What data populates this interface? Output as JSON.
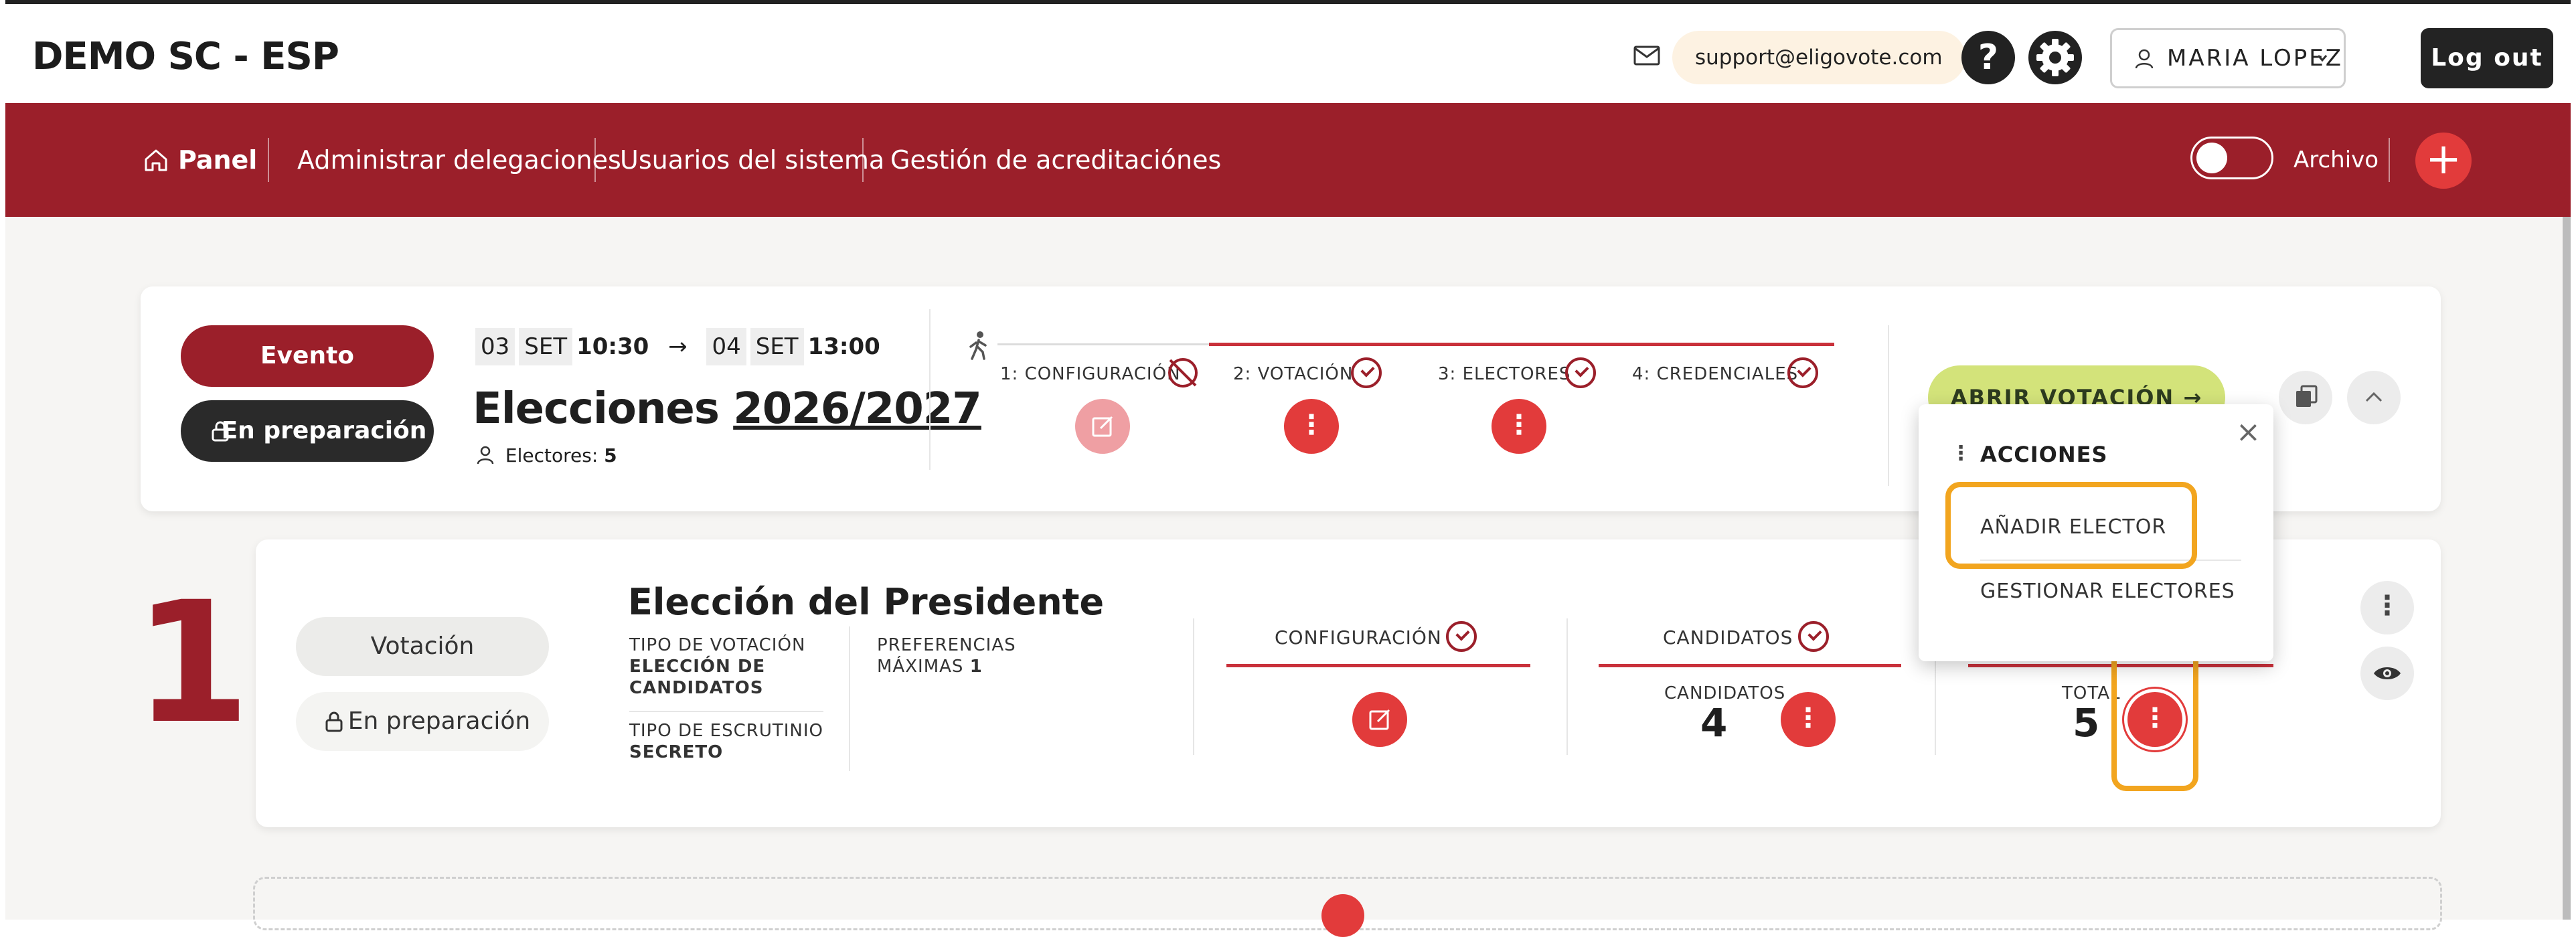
{
  "header": {
    "brand": "DEMO SC - ESP",
    "support_email": "support@eligovote.com",
    "help_symbol": "?",
    "user_name": "MARIA LOPEZ",
    "logout_label": "Log out"
  },
  "nav": {
    "items": [
      {
        "label": "Panel",
        "icon": "home-icon"
      },
      {
        "label": "Administrar delegaciones"
      },
      {
        "label": "Usuarios del sistema"
      },
      {
        "label": "Gestión de acreditaciónes"
      }
    ],
    "archive_label": "Archivo",
    "archive_toggle_on": false,
    "add_symbol": "+"
  },
  "event": {
    "type_label": "Evento",
    "status_label": "En preparación",
    "start_day": "03",
    "start_month": "SET",
    "start_time": "10:30",
    "arrow": "→",
    "end_day": "04",
    "end_month": "SET",
    "end_time": "13:00",
    "title_prefix": "Elecciones",
    "title_link": "2026/2027",
    "voters_label": "Electores:",
    "voters_count": "5",
    "steps": [
      {
        "label": "1: CONFIGURACIÓN",
        "state": "blocked"
      },
      {
        "label": "2: VOTACIÓN",
        "state": "done"
      },
      {
        "label": "3: ELECTORES",
        "state": "done"
      },
      {
        "label": "4: CREDENCIALES",
        "state": "done"
      }
    ],
    "open_vote_label": "ABRIR VOTACIÓN →"
  },
  "actions_popup": {
    "title": "ACCIONES",
    "close_symbol": "×",
    "items": [
      "AÑADIR ELECTOR",
      "GESTIONAR ELECTORES"
    ]
  },
  "vote": {
    "number": "1",
    "type_label": "Votación",
    "status_label": "En preparación",
    "title": "Elección del Presidente",
    "tipo_votacion_label": "TIPO DE VOTACIÓN",
    "tipo_votacion_value": "ELECCIÓN DE CANDIDATOS",
    "tipo_escrutinio_label": "TIPO DE ESCRUTINIO",
    "tipo_escrutinio_value": "SECRETO",
    "preferencias_label": "PREFERENCIAS MÁXIMAS",
    "preferencias_value": "1",
    "config_label": "CONFIGURACIÓN",
    "candidatos_header": "CANDIDATOS",
    "candidatos_label": "CANDIDATOS",
    "candidatos_count": "4",
    "total_label": "TOTAL",
    "total_count": "5"
  },
  "menu_symbol": "⋮"
}
